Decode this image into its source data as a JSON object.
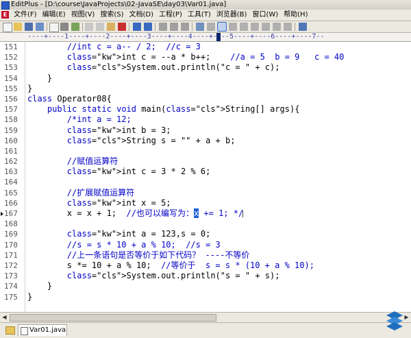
{
  "window": {
    "title": "EditPlus - [D:\\course\\JavaProjects\\02-JavaSE\\day03\\Var01.java]"
  },
  "menu": {
    "items": [
      "文件(F)",
      "编辑(E)",
      "视图(V)",
      "搜索(S)",
      "文档(D)",
      "工程(P)",
      "工具(T)",
      "浏览器(B)",
      "窗口(W)",
      "帮助(H)"
    ]
  },
  "ruler": {
    "text": "----+----1----+----2----+----3----+----4----+----5----+----6----+----7--"
  },
  "editor": {
    "lines": [
      {
        "num": "151",
        "text": "        //int c = a-- / 2;  //c = 3"
      },
      {
        "num": "152",
        "text": "        int c = --a * b++;    //a = 5  b = 9   c = 40"
      },
      {
        "num": "153",
        "text": "        System.out.println(\"c = \" + c);"
      },
      {
        "num": "154",
        "text": "    }"
      },
      {
        "num": "155",
        "text": "}"
      },
      {
        "num": "156",
        "text": "class Operator08{"
      },
      {
        "num": "157",
        "text": "    public static void main(String[] args){"
      },
      {
        "num": "158",
        "text": "        /*int a = 12;"
      },
      {
        "num": "159",
        "text": "        int b = 3;"
      },
      {
        "num": "160",
        "text": "        String s = \"\" + a + b;"
      },
      {
        "num": "161",
        "text": ""
      },
      {
        "num": "162",
        "text": "        //赋值运算符"
      },
      {
        "num": "163",
        "text": "        int c = 3 * 2 % 6;"
      },
      {
        "num": "164",
        "text": ""
      },
      {
        "num": "165",
        "text": "        //扩展赋值运算符"
      },
      {
        "num": "166",
        "text": "        int x = 5;"
      },
      {
        "num": "167",
        "text": "        x = x + 1;  //也可以编写为：x += 1; */"
      },
      {
        "num": "168",
        "text": ""
      },
      {
        "num": "169",
        "text": "        int a = 123,s = 0;"
      },
      {
        "num": "170",
        "text": "        //s = s * 10 + a % 10;  //s = 3"
      },
      {
        "num": "171",
        "text": "        //上一条语句是否等价于如下代码？ ----不等价"
      },
      {
        "num": "172",
        "text": "        s *= 10 + a % 10;  //等价于  s = s * (10 + a % 10);"
      },
      {
        "num": "173",
        "text": "        System.out.println(\"s = \" + s);"
      },
      {
        "num": "174",
        "text": "    }"
      },
      {
        "num": "175",
        "text": "}"
      }
    ]
  },
  "tabs": [
    {
      "label": "Var01.java"
    }
  ],
  "icons": [
    "app-icon",
    "folder-icon",
    "file-icon",
    "logo-icon"
  ],
  "colors": {
    "keyword": "#0000c8",
    "class": "#c80000",
    "selection": "#1f5fd6"
  }
}
